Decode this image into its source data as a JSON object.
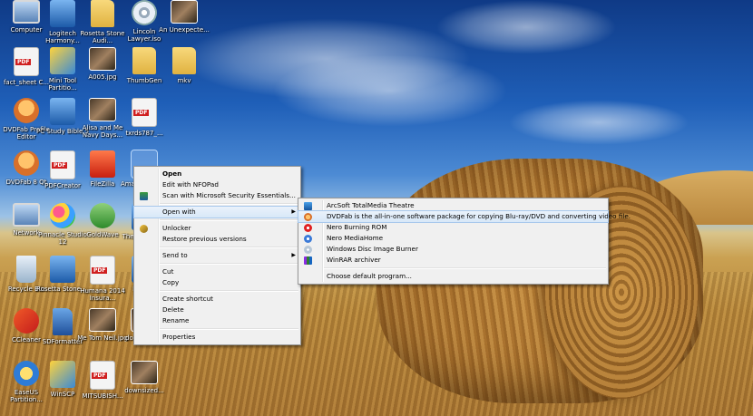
{
  "desktop": {
    "icons": [
      {
        "label": "Computer",
        "icon": "computer-icon"
      },
      {
        "label": "Logitech Harmony...",
        "icon": "logitech-harmony-icon"
      },
      {
        "label": "Rosetta Stone Audi...",
        "icon": "rosetta-stone-audio-icon"
      },
      {
        "label": "Lincoln Lawyer.iso",
        "icon": "iso-disc-icon"
      },
      {
        "label": "An Unexpecte...",
        "icon": "video-file-icon"
      },
      {
        "label": "fact_sheet C...",
        "icon": "pdf-file-icon"
      },
      {
        "label": "Mini Tool Partitio...",
        "icon": "minitool-partition-icon"
      },
      {
        "label": "A005.jpg",
        "icon": "image-file-icon"
      },
      {
        "label": "ThumbGen",
        "icon": "thumbgen-icon"
      },
      {
        "label": "mkv",
        "icon": "folder-icon"
      },
      {
        "label": "DVDFab Profile Editor",
        "icon": "dvdfab-profile-editor-icon"
      },
      {
        "label": "PC Study Bible 5",
        "icon": "pc-study-bible-icon"
      },
      {
        "label": "Alisa and Me Navy Days...",
        "icon": "image-file-icon"
      },
      {
        "label": "txrds787_...",
        "icon": "pdf-file-icon"
      },
      {
        "label": "DVDFab 8 Qt",
        "icon": "dvdfab-icon"
      },
      {
        "label": "PDFCreator",
        "icon": "pdfcreator-icon"
      },
      {
        "label": "FileZilla",
        "icon": "filezilla-icon"
      },
      {
        "label": "Amazing Day...",
        "icon": "video-file-icon"
      },
      {
        "label": "Network",
        "icon": "network-icon"
      },
      {
        "label": "Pinnacle Studio 12",
        "icon": "pinnacle-studio-icon"
      },
      {
        "label": "GoldWave",
        "icon": "goldwave-icon"
      },
      {
        "label": "The Cra... Life I...",
        "icon": "video-file-icon"
      },
      {
        "label": "Recycle Bin",
        "icon": "recycle-bin-icon"
      },
      {
        "label": "Rosetta Stone ...",
        "icon": "rosetta-stone-icon"
      },
      {
        "label": "Humana 2014 Insura...",
        "icon": "pdf-file-icon"
      },
      {
        "label": "Paper...",
        "icon": "video-file-icon"
      },
      {
        "label": "CCleaner",
        "icon": "ccleaner-icon"
      },
      {
        "label": "SDFormatter",
        "icon": "sdformatter-icon"
      },
      {
        "label": "Me Tom Neil.jpg",
        "icon": "image-file-icon"
      },
      {
        "label": "downlized...",
        "icon": "image-file-icon"
      },
      {
        "label": "EaseUS Partition...",
        "icon": "easeus-partition-icon"
      },
      {
        "label": "WinSCP",
        "icon": "winscp-icon"
      },
      {
        "label": "MITSUBISH...",
        "icon": "pdf-file-icon"
      },
      {
        "label": "downsized...",
        "icon": "image-file-icon"
      }
    ]
  },
  "context_menu": {
    "items": [
      {
        "label": "Open",
        "bold": true
      },
      {
        "label": "Edit with NFOPad"
      },
      {
        "label": "Scan with Microsoft Security Essentials...",
        "icon": "shield-icon"
      },
      {
        "label": "Open with",
        "submenu": true
      },
      {
        "label": "Unlocker",
        "icon": "unlocker-wand-icon"
      },
      {
        "label": "Restore previous versions"
      },
      {
        "label": "Send to",
        "submenu": true
      },
      {
        "label": "Cut"
      },
      {
        "label": "Copy"
      },
      {
        "label": "Create shortcut"
      },
      {
        "label": "Delete"
      },
      {
        "label": "Rename"
      },
      {
        "label": "Properties"
      }
    ]
  },
  "open_with_menu": {
    "items": [
      {
        "label": "ArcSoft TotalMedia Theatre",
        "icon": "arcsoft-icon"
      },
      {
        "label": "DVDFab is the all-in-one software package for copying Blu-ray/DVD and converting video file.",
        "icon": "dvdfab-icon"
      },
      {
        "label": "Nero Burning ROM",
        "icon": "nero-burning-rom-icon"
      },
      {
        "label": "Nero MediaHome",
        "icon": "nero-mediahome-icon"
      },
      {
        "label": "Windows Disc Image Burner",
        "icon": "disc-burner-icon"
      },
      {
        "label": "WinRAR archiver",
        "icon": "winrar-icon"
      },
      {
        "label": "Choose default program..."
      }
    ]
  },
  "colors": {
    "menu_bg": "#f0f0f0",
    "menu_hover": "#d8e8f8",
    "icon_label": "#ffffff"
  }
}
